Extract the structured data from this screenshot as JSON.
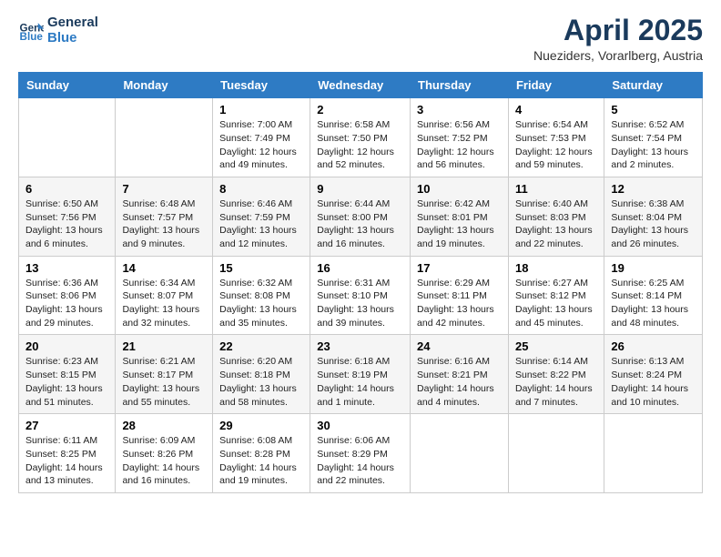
{
  "header": {
    "logo_general": "General",
    "logo_blue": "Blue",
    "title": "April 2025",
    "location": "Nueziders, Vorarlberg, Austria"
  },
  "weekdays": [
    "Sunday",
    "Monday",
    "Tuesday",
    "Wednesday",
    "Thursday",
    "Friday",
    "Saturday"
  ],
  "weeks": [
    [
      {
        "day": "",
        "info": ""
      },
      {
        "day": "",
        "info": ""
      },
      {
        "day": "1",
        "info": "Sunrise: 7:00 AM\nSunset: 7:49 PM\nDaylight: 12 hours and 49 minutes."
      },
      {
        "day": "2",
        "info": "Sunrise: 6:58 AM\nSunset: 7:50 PM\nDaylight: 12 hours and 52 minutes."
      },
      {
        "day": "3",
        "info": "Sunrise: 6:56 AM\nSunset: 7:52 PM\nDaylight: 12 hours and 56 minutes."
      },
      {
        "day": "4",
        "info": "Sunrise: 6:54 AM\nSunset: 7:53 PM\nDaylight: 12 hours and 59 minutes."
      },
      {
        "day": "5",
        "info": "Sunrise: 6:52 AM\nSunset: 7:54 PM\nDaylight: 13 hours and 2 minutes."
      }
    ],
    [
      {
        "day": "6",
        "info": "Sunrise: 6:50 AM\nSunset: 7:56 PM\nDaylight: 13 hours and 6 minutes."
      },
      {
        "day": "7",
        "info": "Sunrise: 6:48 AM\nSunset: 7:57 PM\nDaylight: 13 hours and 9 minutes."
      },
      {
        "day": "8",
        "info": "Sunrise: 6:46 AM\nSunset: 7:59 PM\nDaylight: 13 hours and 12 minutes."
      },
      {
        "day": "9",
        "info": "Sunrise: 6:44 AM\nSunset: 8:00 PM\nDaylight: 13 hours and 16 minutes."
      },
      {
        "day": "10",
        "info": "Sunrise: 6:42 AM\nSunset: 8:01 PM\nDaylight: 13 hours and 19 minutes."
      },
      {
        "day": "11",
        "info": "Sunrise: 6:40 AM\nSunset: 8:03 PM\nDaylight: 13 hours and 22 minutes."
      },
      {
        "day": "12",
        "info": "Sunrise: 6:38 AM\nSunset: 8:04 PM\nDaylight: 13 hours and 26 minutes."
      }
    ],
    [
      {
        "day": "13",
        "info": "Sunrise: 6:36 AM\nSunset: 8:06 PM\nDaylight: 13 hours and 29 minutes."
      },
      {
        "day": "14",
        "info": "Sunrise: 6:34 AM\nSunset: 8:07 PM\nDaylight: 13 hours and 32 minutes."
      },
      {
        "day": "15",
        "info": "Sunrise: 6:32 AM\nSunset: 8:08 PM\nDaylight: 13 hours and 35 minutes."
      },
      {
        "day": "16",
        "info": "Sunrise: 6:31 AM\nSunset: 8:10 PM\nDaylight: 13 hours and 39 minutes."
      },
      {
        "day": "17",
        "info": "Sunrise: 6:29 AM\nSunset: 8:11 PM\nDaylight: 13 hours and 42 minutes."
      },
      {
        "day": "18",
        "info": "Sunrise: 6:27 AM\nSunset: 8:12 PM\nDaylight: 13 hours and 45 minutes."
      },
      {
        "day": "19",
        "info": "Sunrise: 6:25 AM\nSunset: 8:14 PM\nDaylight: 13 hours and 48 minutes."
      }
    ],
    [
      {
        "day": "20",
        "info": "Sunrise: 6:23 AM\nSunset: 8:15 PM\nDaylight: 13 hours and 51 minutes."
      },
      {
        "day": "21",
        "info": "Sunrise: 6:21 AM\nSunset: 8:17 PM\nDaylight: 13 hours and 55 minutes."
      },
      {
        "day": "22",
        "info": "Sunrise: 6:20 AM\nSunset: 8:18 PM\nDaylight: 13 hours and 58 minutes."
      },
      {
        "day": "23",
        "info": "Sunrise: 6:18 AM\nSunset: 8:19 PM\nDaylight: 14 hours and 1 minute."
      },
      {
        "day": "24",
        "info": "Sunrise: 6:16 AM\nSunset: 8:21 PM\nDaylight: 14 hours and 4 minutes."
      },
      {
        "day": "25",
        "info": "Sunrise: 6:14 AM\nSunset: 8:22 PM\nDaylight: 14 hours and 7 minutes."
      },
      {
        "day": "26",
        "info": "Sunrise: 6:13 AM\nSunset: 8:24 PM\nDaylight: 14 hours and 10 minutes."
      }
    ],
    [
      {
        "day": "27",
        "info": "Sunrise: 6:11 AM\nSunset: 8:25 PM\nDaylight: 14 hours and 13 minutes."
      },
      {
        "day": "28",
        "info": "Sunrise: 6:09 AM\nSunset: 8:26 PM\nDaylight: 14 hours and 16 minutes."
      },
      {
        "day": "29",
        "info": "Sunrise: 6:08 AM\nSunset: 8:28 PM\nDaylight: 14 hours and 19 minutes."
      },
      {
        "day": "30",
        "info": "Sunrise: 6:06 AM\nSunset: 8:29 PM\nDaylight: 14 hours and 22 minutes."
      },
      {
        "day": "",
        "info": ""
      },
      {
        "day": "",
        "info": ""
      },
      {
        "day": "",
        "info": ""
      }
    ]
  ]
}
